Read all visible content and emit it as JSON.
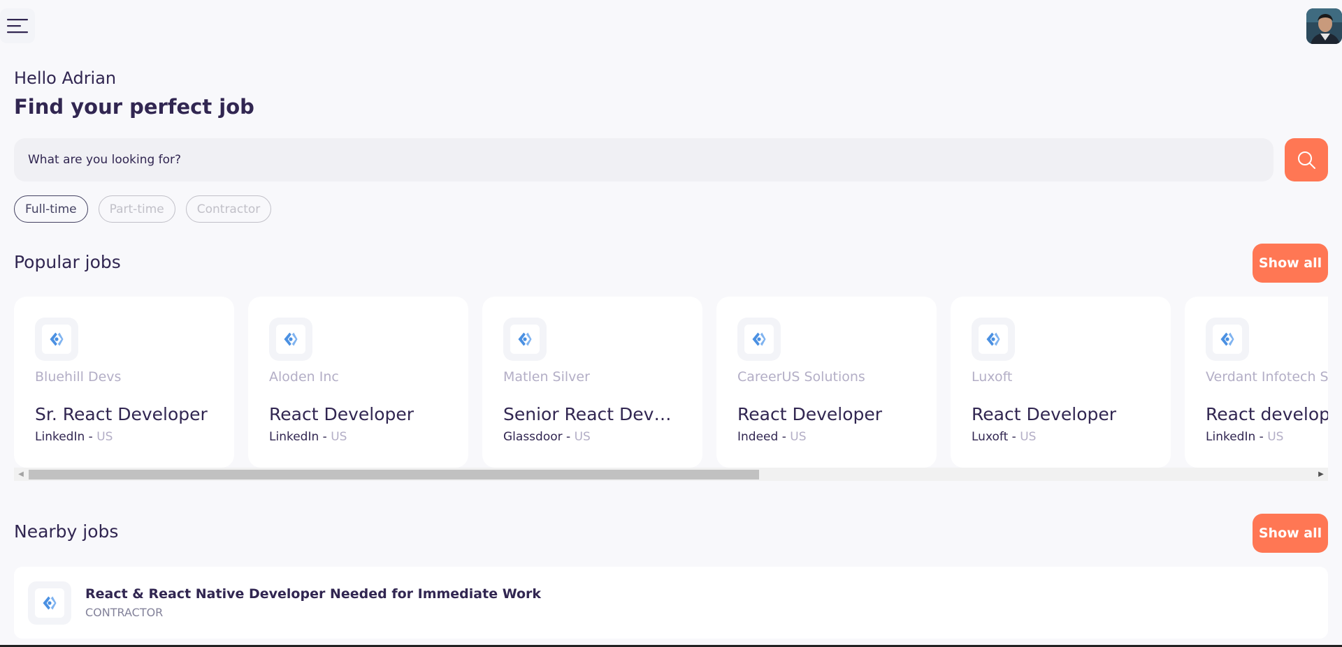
{
  "header": {
    "menu_icon": "menu-icon",
    "avatar_icon": "user-avatar"
  },
  "welcome": {
    "greeting": "Hello Adrian",
    "headline": "Find your perfect job"
  },
  "search": {
    "placeholder": "What are you looking for?",
    "button_icon": "search-icon"
  },
  "job_types": [
    {
      "label": "Full-time",
      "active": true
    },
    {
      "label": "Part-time",
      "active": false
    },
    {
      "label": "Contractor",
      "active": false
    }
  ],
  "popular": {
    "title": "Popular jobs",
    "show_all": "Show all",
    "jobs": [
      {
        "company": "Bluehill Devs",
        "title": "Sr. React Developer",
        "publisher": "LinkedIn",
        "separator": " - ",
        "country": "US"
      },
      {
        "company": "Aloden Inc",
        "title": "React Developer",
        "publisher": "LinkedIn",
        "separator": " - ",
        "country": "US"
      },
      {
        "company": "Matlen Silver",
        "title": "Senior React Develo...",
        "publisher": "Glassdoor",
        "separator": " - ",
        "country": "US"
      },
      {
        "company": "CareerUS Solutions",
        "title": "React Developer",
        "publisher": "Indeed",
        "separator": " - ",
        "country": "US"
      },
      {
        "company": "Luxoft",
        "title": "React Developer",
        "publisher": "Luxoft",
        "separator": " - ",
        "country": "US"
      },
      {
        "company": "Verdant Infotech Sol",
        "title": "React developer",
        "publisher": "LinkedIn",
        "separator": " - ",
        "country": "US"
      }
    ]
  },
  "nearby": {
    "title": "Nearby jobs",
    "show_all": "Show all",
    "jobs": [
      {
        "title": "React & React Native Developer Needed for Immediate Work",
        "type": "CONTRACTOR"
      }
    ]
  },
  "colors": {
    "accent": "#ff7754",
    "primary_text": "#312651",
    "muted_text": "#b3aec6",
    "background": "#f8f8fb"
  }
}
